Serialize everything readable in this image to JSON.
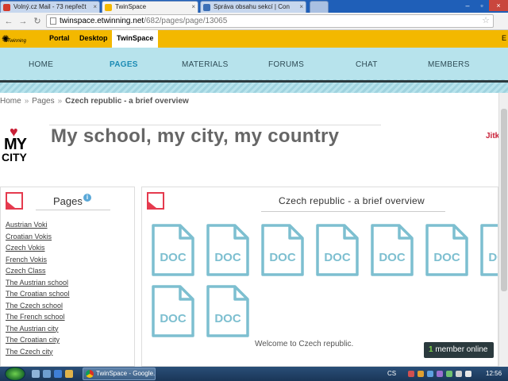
{
  "browser": {
    "tabs": [
      {
        "label": "Volný.cz Mail - 73 nepřečt",
        "favicon_color": "#d33a2c",
        "active": false
      },
      {
        "label": "TwinSpace",
        "favicon_color": "#f3b800",
        "active": true
      },
      {
        "label": "Správa obsahu sekcí | Con",
        "favicon_color": "#3b6fb6",
        "active": false
      }
    ],
    "url_host": "twinspace.etwinning.net",
    "url_path": "/682/pages/page/13065"
  },
  "etwinning_bar": {
    "logo_text": "eTwinning",
    "links": [
      {
        "label": "Portal",
        "active": false
      },
      {
        "label": "Desktop",
        "active": false
      },
      {
        "label": "TwinSpace",
        "active": true
      }
    ],
    "right_text": "E"
  },
  "main_nav": [
    {
      "label": "HOME",
      "active": false
    },
    {
      "label": "PAGES",
      "active": true
    },
    {
      "label": "MATERIALS",
      "active": false
    },
    {
      "label": "FORUMS",
      "active": false
    },
    {
      "label": "CHAT",
      "active": false
    },
    {
      "label": "MEMBERS",
      "active": false
    }
  ],
  "breadcrumb": {
    "items": [
      "Home",
      "Pages"
    ],
    "separator": "»",
    "current": "Czech republic - a brief overview"
  },
  "header": {
    "logo_word1": "MY",
    "logo_word2": "CITY",
    "title": "My school, my city, my country",
    "user_name": "Jitk"
  },
  "pages_panel": {
    "title": "Pages",
    "info_glyph": "i",
    "items": [
      "Austrian Voki",
      "Croatian Vokis",
      "Czech Vokis",
      "French Vokis",
      "Czech Class",
      "The Austrian school",
      "The Croatian school",
      "The Czech school",
      "The French school",
      "The Austrian city",
      "The Croatian city",
      "The Czech city"
    ]
  },
  "content": {
    "title": "Czech republic - a brief overview",
    "doc_label": "DOC",
    "doc_count": 9,
    "welcome": "Welcome to Czech republic."
  },
  "member_badge": {
    "count": "1",
    "label": "member online"
  },
  "taskbar": {
    "task_label": "TwinSpace - Google...",
    "lang": "CS",
    "clock": "12:56"
  },
  "colors": {
    "etwinning_yellow": "#f3b800",
    "nav_bg": "#b7e3ec",
    "accent_red": "#e53a4e",
    "doc_blue": "#7dbfd0"
  }
}
